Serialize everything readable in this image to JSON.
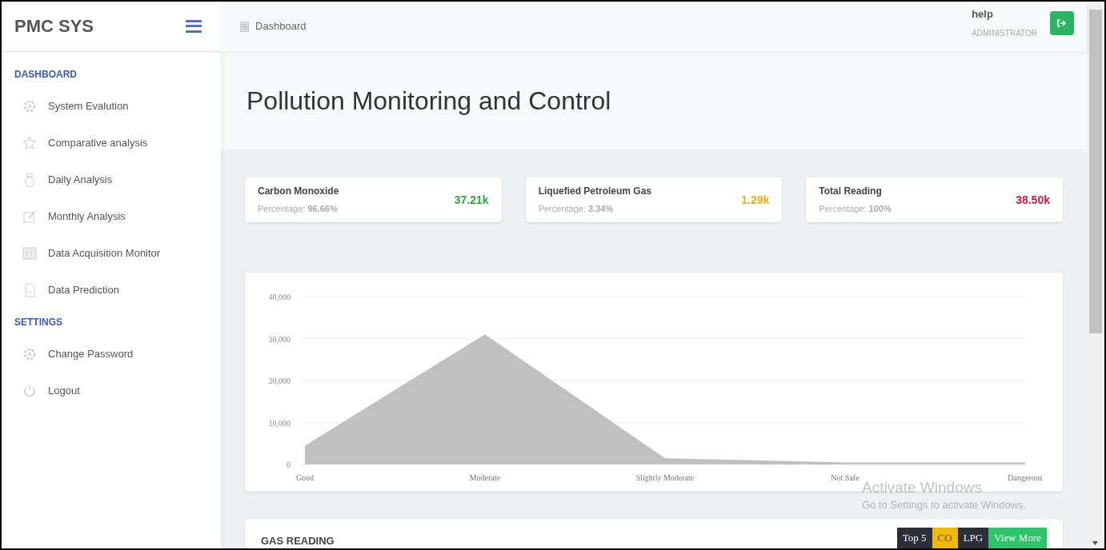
{
  "brand": "PMC SYS",
  "breadcrumb": "Dashboard",
  "user": {
    "name": "help",
    "role": "ADMINISTRATOR"
  },
  "sidebar": [
    {
      "heading": "DASHBOARD",
      "items": [
        {
          "label": "System Evalution"
        },
        {
          "label": "Comparative analysis"
        },
        {
          "label": "Daily Analysis"
        },
        {
          "label": "Monthly Analysis"
        },
        {
          "label": "Data Acquisition Monitor"
        },
        {
          "label": "Data Prediction"
        }
      ]
    },
    {
      "heading": "SETTINGS",
      "items": [
        {
          "label": "Change Password"
        },
        {
          "label": "Logout"
        }
      ]
    }
  ],
  "page_title": "Pollution Monitoring and Control",
  "stats": [
    {
      "title": "Carbon Monoxide",
      "caption": "Percentage: **96.66%**",
      "value": "37.21k",
      "color": "#28a745"
    },
    {
      "title": "Liquefied Petroleum Gas",
      "caption": "Percentage: **3.34%**",
      "value": "1.29k",
      "color": "#f0ad0e"
    },
    {
      "title": "Total Reading",
      "caption": "Percentage: **100%**",
      "value": "38.50k",
      "color": "#dc143c"
    }
  ],
  "chart": {
    "chart_data": {
      "type": "area",
      "categories": [
        "Good",
        "Moderate",
        "Slightly Moderate",
        "Not Safe",
        "Dangerous"
      ],
      "series": [
        {
          "color": "#c0c0c0",
          "values": [
            4500,
            31000,
            1500,
            500,
            500
          ]
        }
      ],
      "grid": true,
      "ylim": [
        0,
        40000
      ],
      "yticks": [
        {
          "value": 0,
          "label": "0"
        },
        {
          "value": 10000,
          "label": "10,000"
        },
        {
          "value": 20000,
          "label": "20,000"
        },
        {
          "value": 30000,
          "label": "30,000"
        },
        {
          "value": 40000,
          "label": "40,000"
        }
      ]
    }
  },
  "gas_reading": {
    "title": "GAS READING",
    "buttons": [
      {
        "label": "Top 5",
        "kind": "dark"
      },
      {
        "label": "CO",
        "kind": "warning"
      },
      {
        "label": "LPG",
        "kind": "dark"
      },
      {
        "label": "View More",
        "kind": "success"
      }
    ]
  },
  "os_notice": {
    "title": "Activate Windows",
    "text": "Go to Settings to activate Windows."
  }
}
